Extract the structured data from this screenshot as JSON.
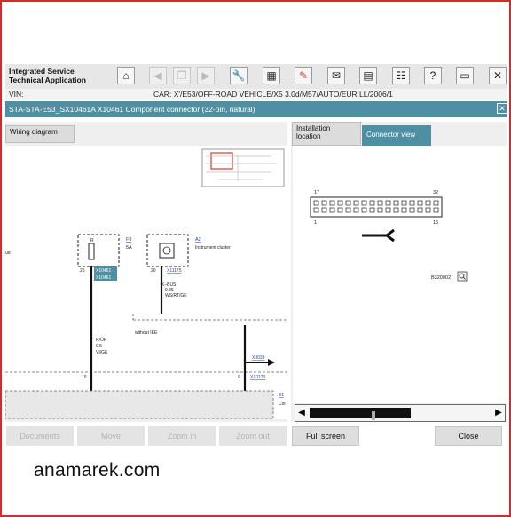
{
  "app": {
    "title_line1": "Integrated Service",
    "title_line2": "Technical Application"
  },
  "toolbar": {
    "icons": [
      "home-icon",
      "back-icon",
      "copy-icon",
      "forward-icon",
      "wrench-icon",
      "scan-icon",
      "diagnosis-icon",
      "mail-icon",
      "save-icon",
      "help-icon",
      "dropdown-icon",
      "close-icon"
    ]
  },
  "vehicle": {
    "vin_label": "VIN:",
    "car_label": "CAR:",
    "car_value": "X'/E53/OFF-ROAD VEHICLE/X5 3.0d/M57/AUTO/EUR LL/2006/1"
  },
  "window": {
    "title": "STA-STA-E53_SX10461A X10461 Component connector (32-pin, natural)",
    "close": "✕"
  },
  "tabs_left": {
    "wiring": "Wiring diagram"
  },
  "tabs_right": {
    "installation_line1": "Installation",
    "installation_line2": "location",
    "connector": "Connector view"
  },
  "diagram": {
    "fuse_label": "F9",
    "fuse_rating": "5A",
    "cluster_label": "A2",
    "cluster_name": "Instrument cluster",
    "pin25": "25",
    "pin20": "20",
    "conn1": "X10461",
    "conn2": "X10461",
    "conn_cluster": "X11175",
    "kbus_l1": "K–BUS",
    "kbus_l2": "0.35",
    "kbus_l3": "WS/RT/GE",
    "wire_l1": "R/ÖR",
    "wire_l2": "0.5",
    "wire_l3": "VI/GE",
    "without_ike": "without IKE",
    "pin10": "10",
    "pin9": "9",
    "conn_x3039": "X3039",
    "conn_x10170": "X10170",
    "label_e": "E1",
    "label_col": "Col",
    "left_cut": "ud"
  },
  "connector_view": {
    "pin_top_left": "17",
    "pin_top_right": "32",
    "pin_bottom_left": "1",
    "pin_bottom_right": "16",
    "image_id": "B320002"
  },
  "buttons": {
    "documents": "Documents",
    "move": "Move",
    "zoom_in": "Zoom in",
    "zoom_out": "Zoom out",
    "full_screen": "Full screen",
    "close": "Close"
  },
  "watermark": "anamarek.com",
  "colors": {
    "accent": "#4e8fa3",
    "frame": "#d42a2a",
    "highlight_red": "#d93a2f",
    "link_blue": "#2a3fb0",
    "connector_tag": "#4e8fa3"
  }
}
